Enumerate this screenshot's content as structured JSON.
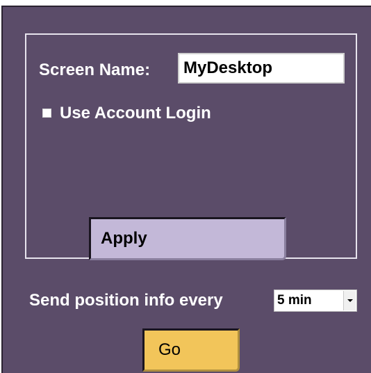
{
  "settings": {
    "screen_name_label": "Screen Name:",
    "screen_name_value": "MyDesktop",
    "use_account_login_label": "Use Account Login",
    "use_account_login_checked": false,
    "apply_label": "Apply"
  },
  "position": {
    "send_label": "Send position info every",
    "interval_value": "5 min",
    "go_label": "Go"
  },
  "colors": {
    "panel_bg": "#5b4c69",
    "apply_button_bg": "#c3b8d8",
    "go_button_bg": "#f2c55a",
    "text": "#ffffff"
  }
}
